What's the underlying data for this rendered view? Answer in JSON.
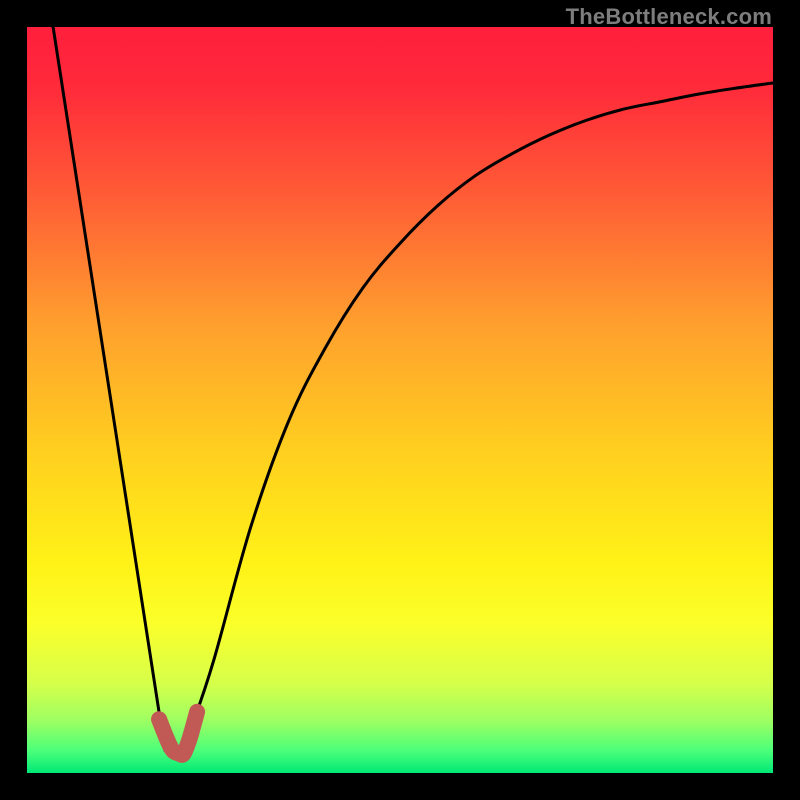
{
  "watermark": "TheBottleneck.com",
  "chart_data": {
    "type": "line",
    "title": "",
    "xlabel": "",
    "ylabel": "",
    "xlim": [
      0,
      100
    ],
    "ylim": [
      0,
      100
    ],
    "series": [
      {
        "name": "left-descent",
        "x": [
          3.5,
          18.5
        ],
        "values": [
          100,
          3
        ]
      },
      {
        "name": "right-curve",
        "x": [
          22,
          25,
          30,
          35,
          40,
          45,
          50,
          55,
          60,
          65,
          70,
          75,
          80,
          85,
          90,
          95,
          100
        ],
        "values": [
          6,
          15,
          33,
          47,
          57,
          65,
          71,
          76,
          80,
          83,
          85.5,
          87.5,
          89,
          90,
          91,
          91.8,
          92.5
        ]
      },
      {
        "name": "marker-stroke",
        "x": [
          17.7,
          19.3,
          20.4,
          21.0,
          21.7,
          22.2,
          22.8
        ],
        "values": [
          7.2,
          3.4,
          2.6,
          2.6,
          4.3,
          6.0,
          8.2
        ]
      }
    ],
    "gradient_stops": [
      {
        "offset": 0.0,
        "color": "#ff1f3c"
      },
      {
        "offset": 0.08,
        "color": "#ff2a3a"
      },
      {
        "offset": 0.22,
        "color": "#ff5a36"
      },
      {
        "offset": 0.4,
        "color": "#ffa02e"
      },
      {
        "offset": 0.58,
        "color": "#ffd21e"
      },
      {
        "offset": 0.72,
        "color": "#fff217"
      },
      {
        "offset": 0.8,
        "color": "#fbff2a"
      },
      {
        "offset": 0.88,
        "color": "#d6ff4a"
      },
      {
        "offset": 0.93,
        "color": "#9dff62"
      },
      {
        "offset": 0.97,
        "color": "#4cff7a"
      },
      {
        "offset": 1.0,
        "color": "#00e876"
      }
    ],
    "marker_color": "#c15a55",
    "curve_color": "#000000"
  }
}
